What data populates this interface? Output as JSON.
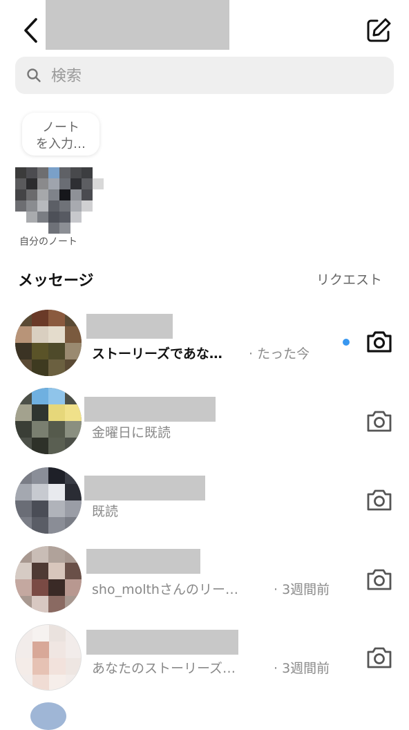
{
  "search": {
    "placeholder": "検索"
  },
  "note": {
    "bubble_line1": "ノート",
    "bubble_line2": "を入力…",
    "label": "自分のノート"
  },
  "sections": {
    "messages_heading": "メッセージ",
    "requests_link": "リクエスト"
  },
  "conversations": [
    {
      "preview": "ストーリーズであな…",
      "time": "· たった今",
      "unread": true,
      "icon": "camera-icon"
    },
    {
      "preview": "金曜日に既読",
      "time": "",
      "unread": false,
      "icon": "camera-icon"
    },
    {
      "preview": "既読",
      "time": "",
      "unread": false,
      "icon": "camera-icon"
    },
    {
      "preview": "sho_molthさんのリー…",
      "time": "· 3週間前",
      "unread": false,
      "icon": "camera-icon"
    },
    {
      "preview": "あなたのストーリーズ…",
      "time": "· 3週間前",
      "unread": false,
      "icon": "camera-icon"
    }
  ],
  "colors": {
    "unread_dot": "#3897f0",
    "search_bg": "#efefef",
    "redaction": "#c8c8c8"
  }
}
